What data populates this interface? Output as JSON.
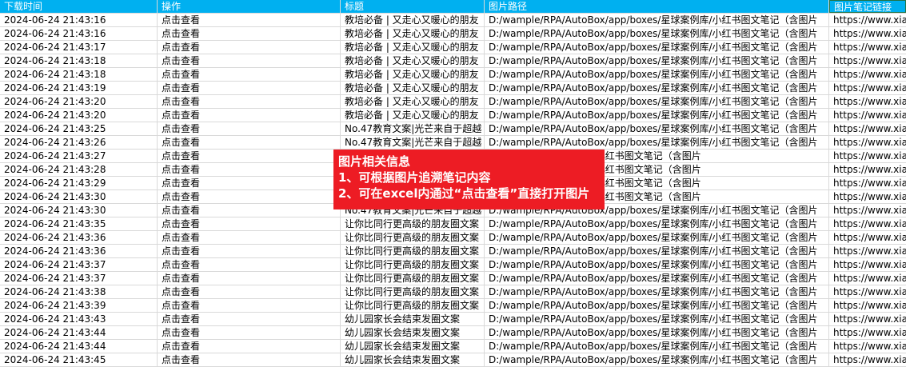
{
  "headers": [
    "下载时间",
    "操作",
    "标题",
    "图片路径",
    "图片笔记链接"
  ],
  "rows": [
    [
      "2024-06-24 21:43:16",
      "点击查看",
      "教培必备 | 又走心又暖心的朋友",
      "D:/wample/RPA/AutoBox/app/boxes/星球案例库/小红书图文笔记（含图片",
      "https://www.xiao"
    ],
    [
      "2024-06-24 21:43:16",
      "点击查看",
      "教培必备 | 又走心又暖心的朋友",
      "D:/wample/RPA/AutoBox/app/boxes/星球案例库/小红书图文笔记（含图片",
      "https://www.xiao"
    ],
    [
      "2024-06-24 21:43:17",
      "点击查看",
      "教培必备 | 又走心又暖心的朋友",
      "D:/wample/RPA/AutoBox/app/boxes/星球案例库/小红书图文笔记（含图片",
      "https://www.xiao"
    ],
    [
      "2024-06-24 21:43:18",
      "点击查看",
      "教培必备 | 又走心又暖心的朋友",
      "D:/wample/RPA/AutoBox/app/boxes/星球案例库/小红书图文笔记（含图片",
      "https://www.xiao"
    ],
    [
      "2024-06-24 21:43:18",
      "点击查看",
      "教培必备 | 又走心又暖心的朋友",
      "D:/wample/RPA/AutoBox/app/boxes/星球案例库/小红书图文笔记（含图片",
      "https://www.xiao"
    ],
    [
      "2024-06-24 21:43:19",
      "点击查看",
      "教培必备 | 又走心又暖心的朋友",
      "D:/wample/RPA/AutoBox/app/boxes/星球案例库/小红书图文笔记（含图片",
      "https://www.xiao"
    ],
    [
      "2024-06-24 21:43:20",
      "点击查看",
      "教培必备 | 又走心又暖心的朋友",
      "D:/wample/RPA/AutoBox/app/boxes/星球案例库/小红书图文笔记（含图片",
      "https://www.xiao"
    ],
    [
      "2024-06-24 21:43:20",
      "点击查看",
      "教培必备 | 又走心又暖心的朋友",
      "D:/wample/RPA/AutoBox/app/boxes/星球案例库/小红书图文笔记（含图片",
      "https://www.xiao"
    ],
    [
      "2024-06-24 21:43:25",
      "点击查看",
      "No.47教育文案|光芒来自于超越",
      "D:/wample/RPA/AutoBox/app/boxes/星球案例库/小红书图文笔记（含图片",
      "https://www.xiao"
    ],
    [
      "2024-06-24 21:43:26",
      "点击查看",
      "No.47教育文案|光芒来自于超越",
      "D:/wample/RPA/AutoBox/app/boxes/星球案例库/小红书图文笔记（含图片",
      "https://www.xiao"
    ],
    [
      "2024-06-24 21:43:27",
      "点击查看",
      "",
      "/app/boxes/星球案例库/小红书图文笔记（含图片",
      "https://www.xiao"
    ],
    [
      "2024-06-24 21:43:28",
      "点击查看",
      "",
      "/app/boxes/星球案例库/小红书图文笔记（含图片",
      "https://www.xiao"
    ],
    [
      "2024-06-24 21:43:29",
      "点击查看",
      "",
      "/app/boxes/星球案例库/小红书图文笔记（含图片",
      "https://www.xiao"
    ],
    [
      "2024-06-24 21:43:30",
      "点击查看",
      "",
      "/app/boxes/星球案例库/小红书图文笔记（含图片",
      "https://www.xiao"
    ],
    [
      "2024-06-24 21:43:30",
      "点击查看",
      "No.47教育文案|光芒来自于超越",
      "D:/wample/RPA/AutoBox/app/boxes/星球案例库/小红书图文笔记（含图片",
      "https://www.xiao"
    ],
    [
      "2024-06-24 21:43:35",
      "点击查看",
      "让你比同行更高级的朋友圈文案",
      "D:/wample/RPA/AutoBox/app/boxes/星球案例库/小红书图文笔记（含图片",
      "https://www.xiao"
    ],
    [
      "2024-06-24 21:43:36",
      "点击查看",
      "让你比同行更高级的朋友圈文案",
      "D:/wample/RPA/AutoBox/app/boxes/星球案例库/小红书图文笔记（含图片",
      "https://www.xiao"
    ],
    [
      "2024-06-24 21:43:36",
      "点击查看",
      "让你比同行更高级的朋友圈文案",
      "D:/wample/RPA/AutoBox/app/boxes/星球案例库/小红书图文笔记（含图片",
      "https://www.xiao"
    ],
    [
      "2024-06-24 21:43:37",
      "点击查看",
      "让你比同行更高级的朋友圈文案",
      "D:/wample/RPA/AutoBox/app/boxes/星球案例库/小红书图文笔记（含图片",
      "https://www.xiao"
    ],
    [
      "2024-06-24 21:43:37",
      "点击查看",
      "让你比同行更高级的朋友圈文案",
      "D:/wample/RPA/AutoBox/app/boxes/星球案例库/小红书图文笔记（含图片",
      "https://www.xiao"
    ],
    [
      "2024-06-24 21:43:38",
      "点击查看",
      "让你比同行更高级的朋友圈文案",
      "D:/wample/RPA/AutoBox/app/boxes/星球案例库/小红书图文笔记（含图片",
      "https://www.xiao"
    ],
    [
      "2024-06-24 21:43:39",
      "点击查看",
      "让你比同行更高级的朋友圈文案",
      "D:/wample/RPA/AutoBox/app/boxes/星球案例库/小红书图文笔记（含图片",
      "https://www.xiao"
    ],
    [
      "2024-06-24 21:43:43",
      "点击查看",
      "幼儿园家长会结束发圈文案",
      "D:/wample/RPA/AutoBox/app/boxes/星球案例库/小红书图文笔记（含图片",
      "https://www.xiao"
    ],
    [
      "2024-06-24 21:43:44",
      "点击查看",
      "幼儿园家长会结束发圈文案",
      "D:/wample/RPA/AutoBox/app/boxes/星球案例库/小红书图文笔记（含图片",
      "https://www.xiao"
    ],
    [
      "2024-06-24 21:43:44",
      "点击查看",
      "幼儿园家长会结束发圈文案",
      "D:/wample/RPA/AutoBox/app/boxes/星球案例库/小红书图文笔记（含图片",
      "https://www.xiao"
    ],
    [
      "2024-06-24 21:43:45",
      "点击查看",
      "幼儿园家长会结束发圈文案",
      "D:/wample/RPA/AutoBox/app/boxes/星球案例库/小红书图文笔记（含图片",
      "https://www.xiao"
    ]
  ],
  "callout": {
    "title": "图片相关信息",
    "line1": "1、可根据图片追溯笔记内容",
    "line2": "2、可在excel内通过“点击查看”直接打开图片"
  },
  "colors": {
    "header_bg": "#00b0f0",
    "callout_bg": "#ed1c24",
    "grid": "#d9d9d9"
  }
}
